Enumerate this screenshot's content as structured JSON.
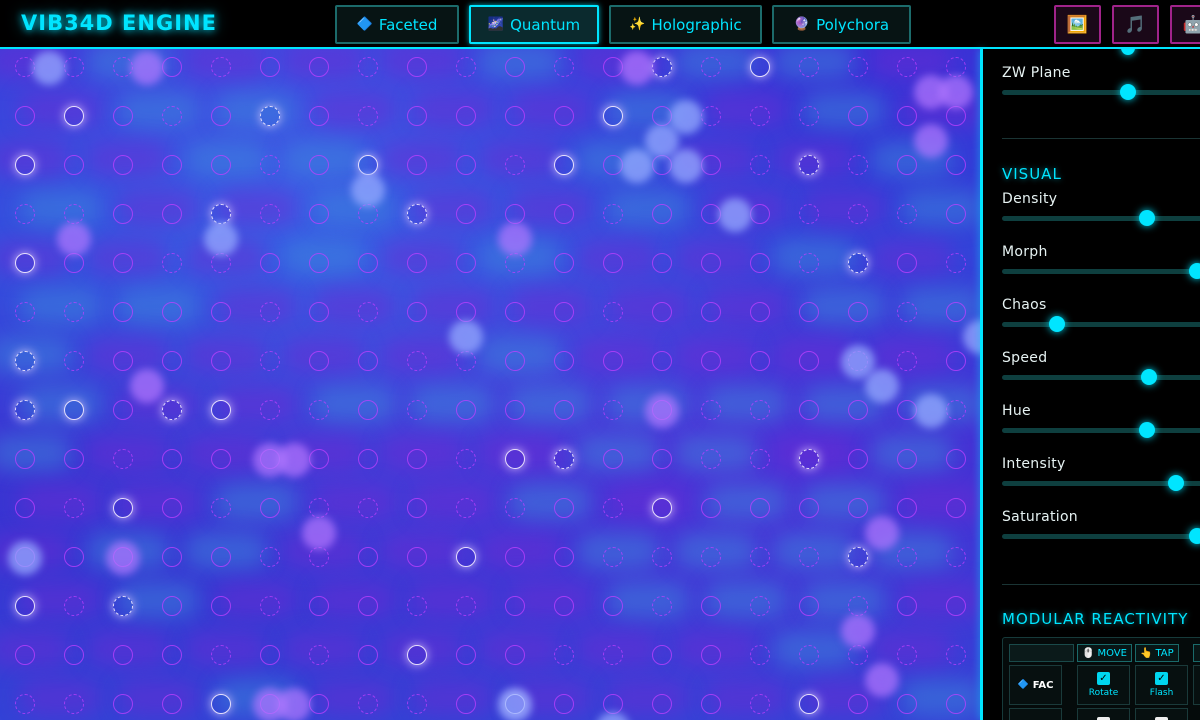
{
  "app": {
    "title": "VIB34D ENGINE"
  },
  "systems": [
    {
      "label": "Faceted",
      "icon": "🔷",
      "icon_name": "diamond-icon",
      "active": false
    },
    {
      "label": "Quantum",
      "icon": "🌌",
      "icon_name": "galaxy-icon",
      "active": true
    },
    {
      "label": "Holographic",
      "icon": "✨",
      "icon_name": "sparkles-icon",
      "active": false
    },
    {
      "label": "Polychora",
      "icon": "🔮",
      "icon_name": "crystal-ball-icon",
      "active": false
    }
  ],
  "tools": [
    {
      "icon": "🖼️",
      "icon_name": "picture-icon"
    },
    {
      "icon": "🎵",
      "icon_name": "music-note-icon"
    },
    {
      "icon": "🤖",
      "icon_name": "robot-icon"
    }
  ],
  "panel": {
    "rotation_sliders": [
      {
        "label": "ZW Plane",
        "value": 0.6
      }
    ],
    "visual_title": "VISUAL",
    "visual_sliders": [
      {
        "label": "Density",
        "value": 0.69
      },
      {
        "label": "Morph",
        "value": 0.93
      },
      {
        "label": "Chaos",
        "value": 0.26
      },
      {
        "label": "Speed",
        "value": 0.7
      },
      {
        "label": "Hue",
        "value": 0.69
      },
      {
        "label": "Intensity",
        "value": 0.83
      },
      {
        "label": "Saturation",
        "value": 0.93
      }
    ],
    "reactivity_title": "MODULAR REACTIVITY",
    "reactivity": {
      "modes": [
        {
          "label": "MOVE",
          "icon": "🖱️",
          "icon_name": "mouse-icon"
        },
        {
          "label": "TAP",
          "icon": "👆",
          "icon_name": "pointer-icon"
        }
      ],
      "row_label": "FAC",
      "row_icon": "🔷",
      "checks": [
        {
          "label": "Rotate",
          "checked": true
        },
        {
          "label": "Flash",
          "checked": true
        }
      ]
    }
  },
  "colors": {
    "accent": "#00e5ff",
    "canvas": "#3a32d6",
    "ring": "#c040ff"
  }
}
